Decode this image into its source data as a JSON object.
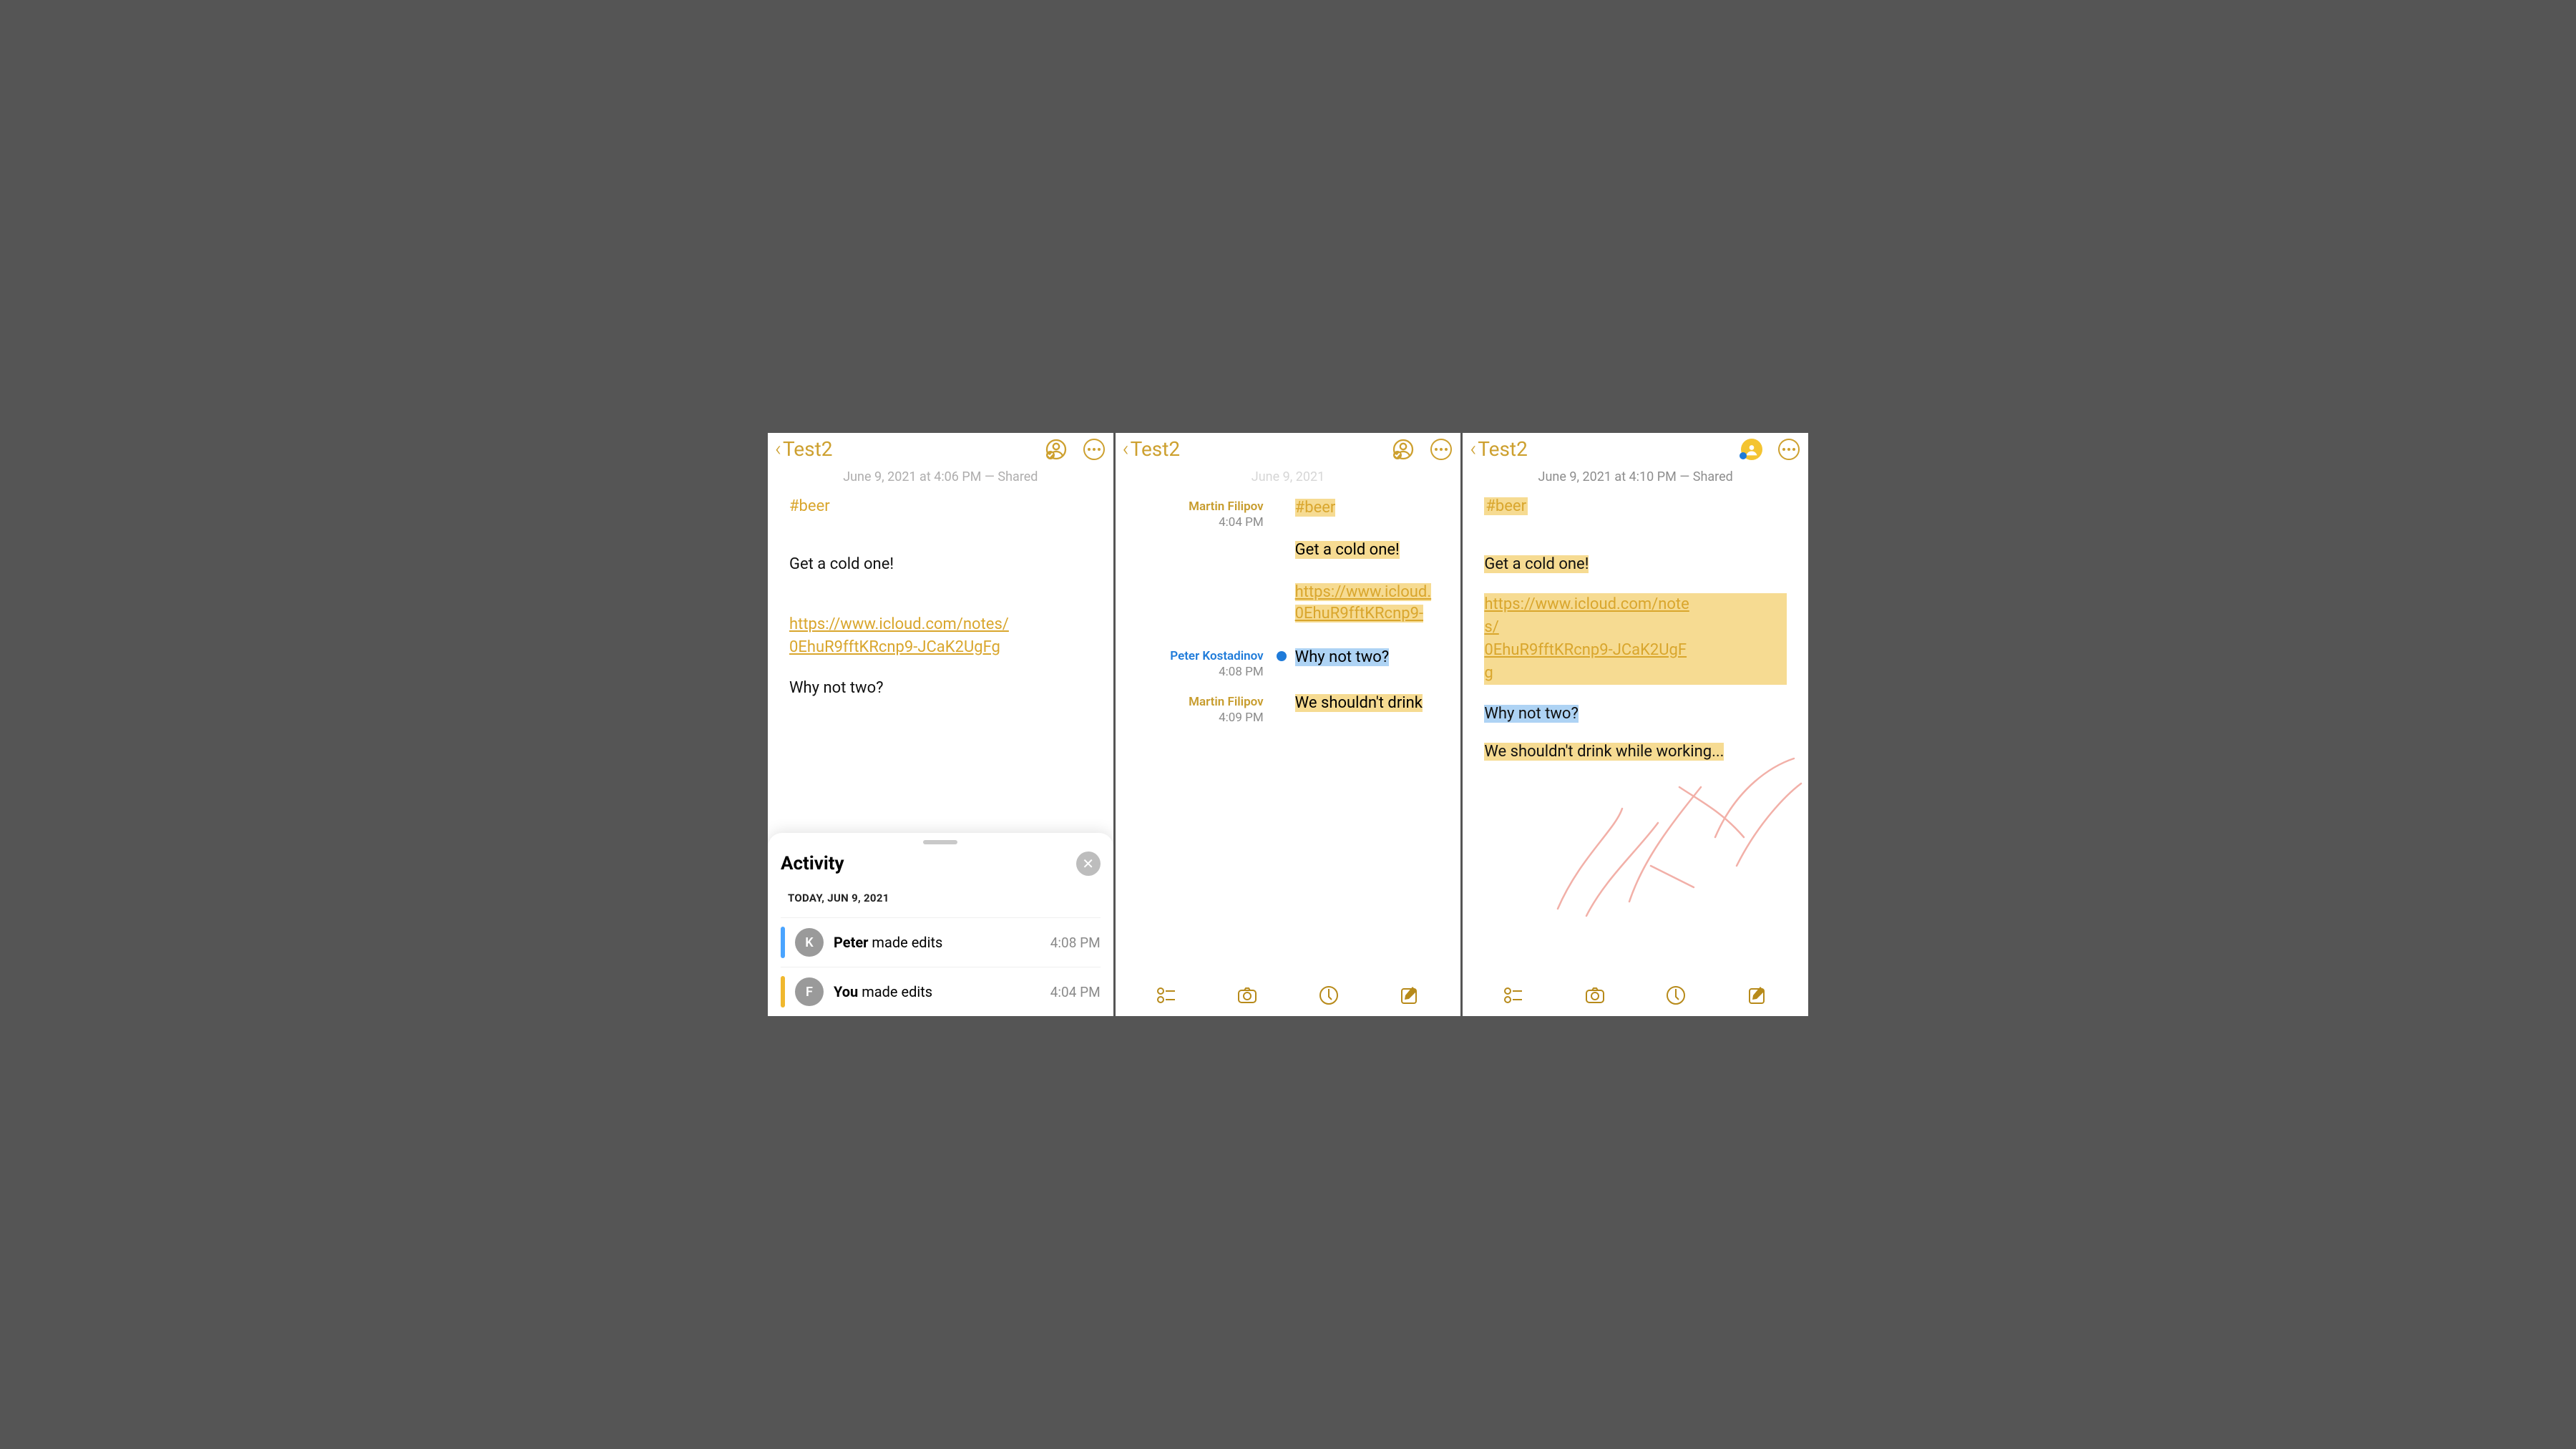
{
  "screen1": {
    "back_title": "Test2",
    "meta": "June 9, 2021 at 4:06 PM — Shared",
    "tag": "#beer",
    "line1": "Get a cold one!",
    "link_a": "https://www.icloud.com/notes/",
    "link_b": "0EhuR9fftKRcnp9-JCaK2UgFg",
    "line2": "Why not two?",
    "sheet": {
      "title": "Activity",
      "day": "TODAY, JUN 9, 2021",
      "rows": [
        {
          "initial": "K",
          "who": "Peter",
          "verb": " made edits",
          "time": "4:08 PM"
        },
        {
          "initial": "F",
          "who": "You",
          "verb": " made edits",
          "time": "4:04 PM"
        }
      ]
    }
  },
  "screen2": {
    "back_title": "Test2",
    "meta": "June 9, 2021",
    "attrib": [
      {
        "name": "Martin Filipov",
        "time": "4:04 PM",
        "color": "y"
      },
      {
        "name": "Peter Kostadinov",
        "time": "4:08 PM",
        "color": "b"
      },
      {
        "name": "Martin Filipov",
        "time": "4:09 PM",
        "color": "y"
      }
    ],
    "tag": "#beer",
    "line1": "Get a cold one!",
    "link_a": "https://www.icloud.",
    "link_b": "0EhuR9fftKRcnp9-",
    "line2": "Why not two?",
    "line3": "We shouldn't drink"
  },
  "screen3": {
    "back_title": "Test2",
    "meta": "June 9, 2021 at 4:10 PM — Shared",
    "tag": "#beer",
    "line1": "Get a cold one!",
    "link_a": "https://www.icloud.com/notes/",
    "link_b": "0EhuR9fftKRcnp9-JCaK2UgFg",
    "line2": "Why not two?",
    "line3": "We shouldn't drink while working..."
  }
}
